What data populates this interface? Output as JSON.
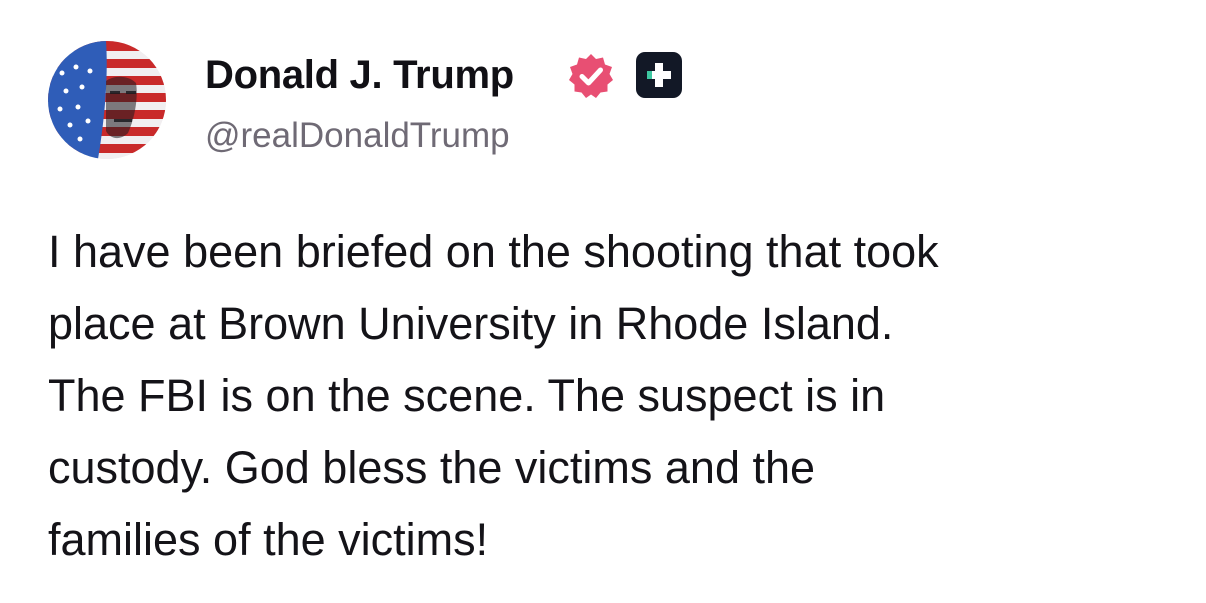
{
  "author": {
    "display_name": "Donald J. Trump",
    "handle": "@realDonaldTrump",
    "verified_badge_color": "#e84f73",
    "plus_badge_color": "#121826"
  },
  "post": {
    "lines": [
      "I have been briefed on the shooting that took",
      "place at Brown University in Rhode Island.",
      "The FBI is on the scene. The suspect is in",
      "custody. God bless the victims and the",
      "families of the victims!"
    ]
  },
  "icons": {
    "avatar": "avatar-flag-portrait",
    "verified": "verified-check-icon",
    "plus": "plus-badge-icon"
  }
}
